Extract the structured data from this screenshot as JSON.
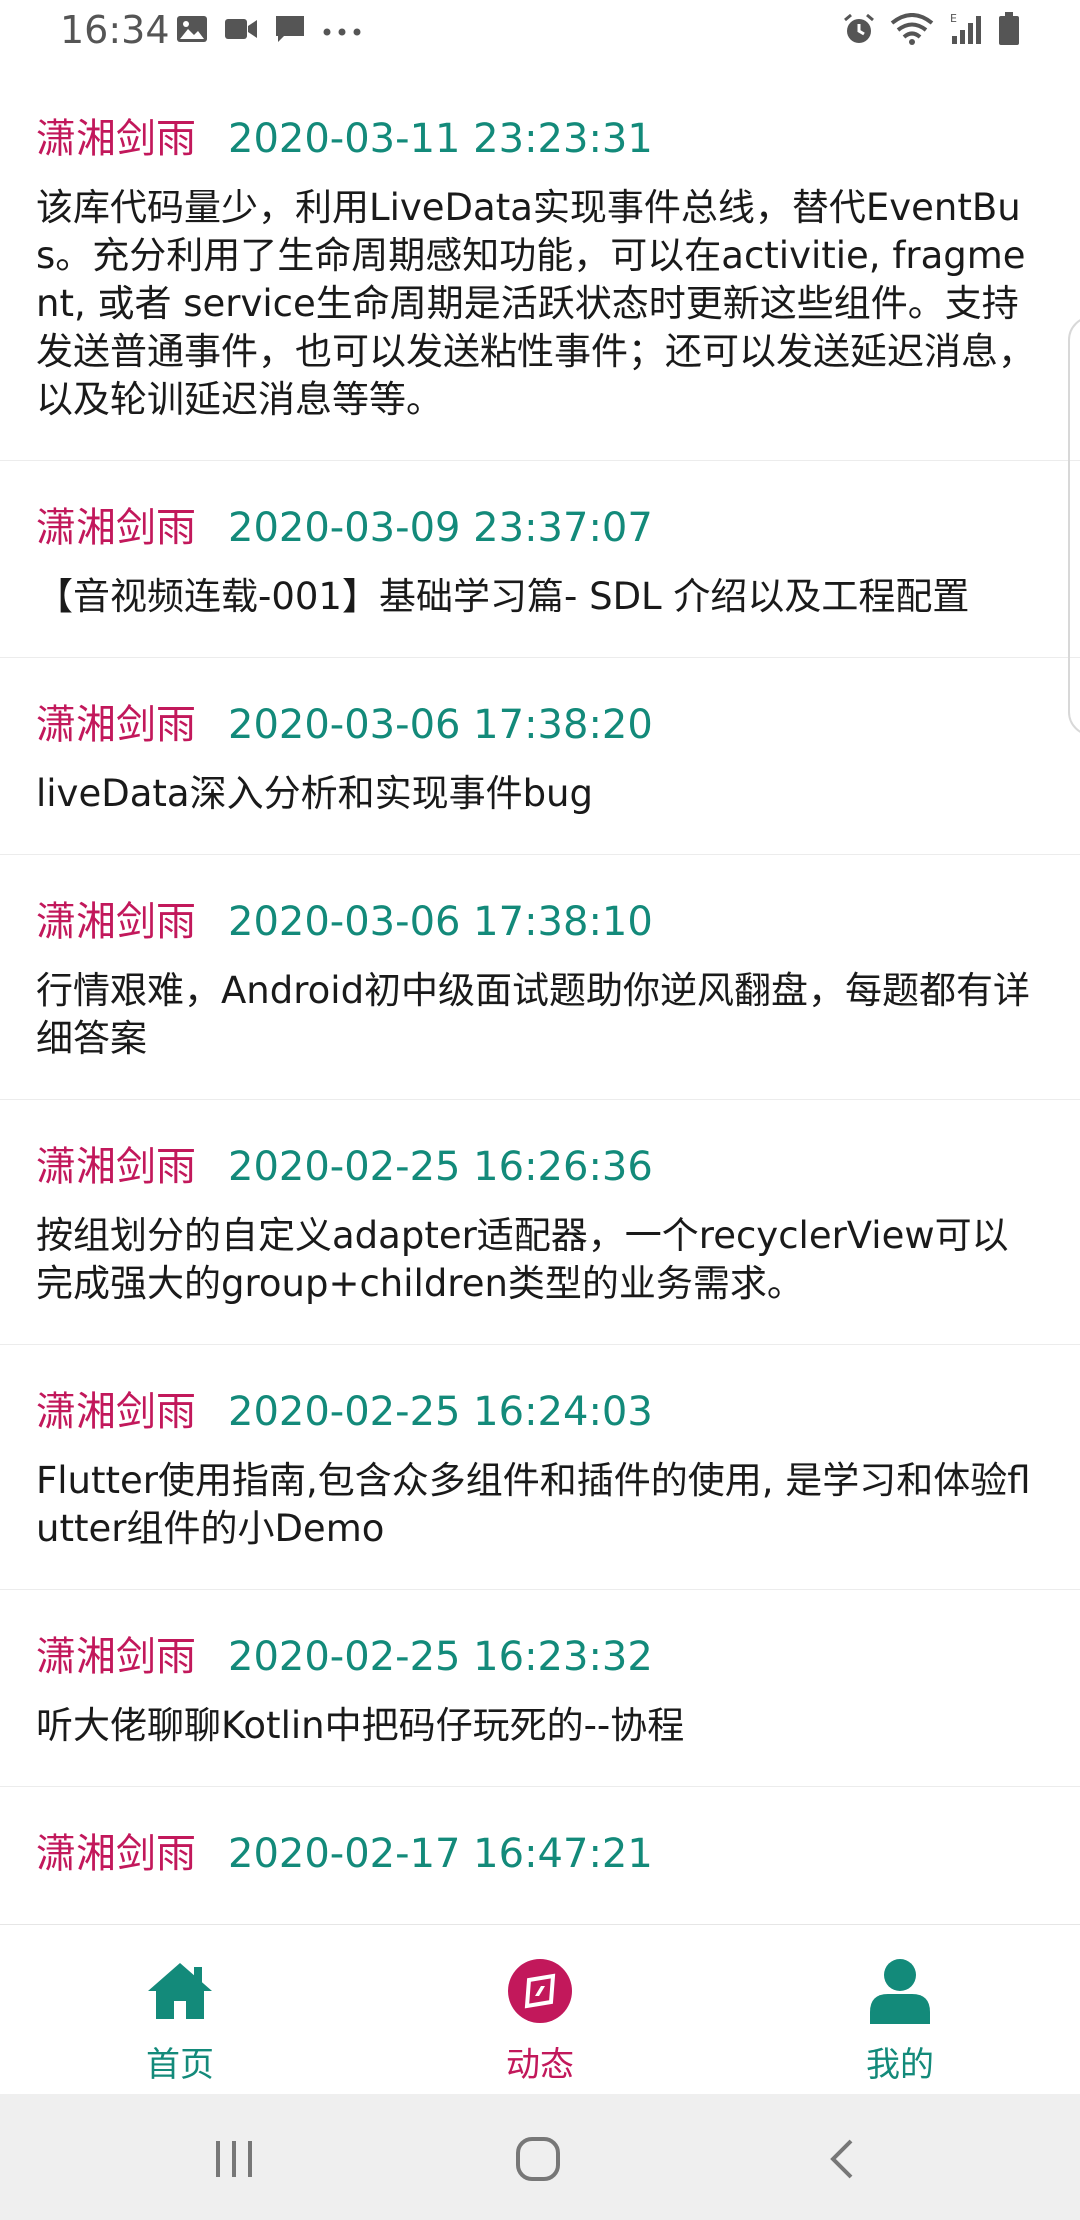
{
  "status_bar": {
    "time": "16:34",
    "left_icons": [
      "image-icon",
      "video-icon",
      "message-icon",
      "more-icon"
    ],
    "right_icons": [
      "alarm-icon",
      "wifi-icon",
      "signal-icon",
      "battery-icon"
    ]
  },
  "feed": {
    "items": [
      {
        "author": "潇湘剑雨",
        "time": "2020-03-11 23:23:31",
        "title": "该库代码量少，利用LiveData实现事件总线，替代EventBus。充分利用了生命周期感知功能，可以在activitie, fragment, 或者 service生命周期是活跃状态时更新这些组件。支持发送普通事件，也可以发送粘性事件；还可以发送延迟消息，以及轮训延迟消息等等。"
      },
      {
        "author": "潇湘剑雨",
        "time": "2020-03-09 23:37:07",
        "title": "【音视频连载-001】基础学习篇- SDL 介绍以及工程配置"
      },
      {
        "author": "潇湘剑雨",
        "time": "2020-03-06 17:38:20",
        "title": "liveData深入分析和实现事件bug"
      },
      {
        "author": "潇湘剑雨",
        "time": "2020-03-06 17:38:10",
        "title": "行情艰难，Android初中级面试题助你逆风翻盘，每题都有详细答案"
      },
      {
        "author": "潇湘剑雨",
        "time": "2020-02-25 16:26:36",
        "title": "按组划分的自定义adapter适配器，一个recyclerView可以完成强大的group+children类型的业务需求。"
      },
      {
        "author": "潇湘剑雨",
        "time": "2020-02-25 16:24:03",
        "title": "Flutter使用指南,包含众多组件和插件的使用, 是学习和体验flutter组件的小Demo"
      },
      {
        "author": "潇湘剑雨",
        "time": "2020-02-25 16:23:32",
        "title": "听大佬聊聊Kotlin中把码仔玩死的--协程"
      },
      {
        "author": "潇湘剑雨",
        "time": "2020-02-17 16:47:21",
        "title": ""
      }
    ]
  },
  "bottom_nav": {
    "home": {
      "label": "首页",
      "icon": "home-icon"
    },
    "dynamic": {
      "label": "动态",
      "icon": "compass-icon"
    },
    "mine": {
      "label": "我的",
      "icon": "person-icon"
    }
  },
  "system_nav": {
    "buttons": [
      "recents-icon",
      "home-circle-icon",
      "back-icon"
    ]
  },
  "colors": {
    "author": "#c2185b",
    "time": "#138a7a",
    "nav_active": "#c2185b",
    "nav_inactive": "#138a7a"
  }
}
